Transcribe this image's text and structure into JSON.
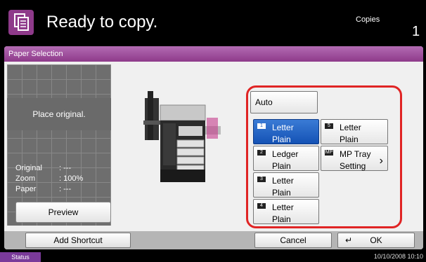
{
  "header": {
    "status": "Ready to copy.",
    "copies_label": "Copies",
    "copies_value": "1",
    "icon": "copy-icon"
  },
  "panel": {
    "title": "Paper Selection",
    "preview": {
      "message": "Place original.",
      "info": [
        {
          "label": "Original",
          "value": ": ---"
        },
        {
          "label": "Zoom",
          "value": ": 100%"
        },
        {
          "label": "Paper",
          "value": ": ---"
        }
      ],
      "button_label": "Preview"
    },
    "options": {
      "auto": "Auto",
      "items": [
        {
          "id": "cassette-1",
          "number": "1",
          "size": "Letter",
          "type": "Plain",
          "selected": true
        },
        {
          "id": "cassette-2",
          "number": "2",
          "size": "Ledger",
          "type": "Plain",
          "selected": false
        },
        {
          "id": "cassette-3",
          "number": "3",
          "size": "Letter",
          "type": "Plain",
          "selected": false
        },
        {
          "id": "cassette-4",
          "number": "4",
          "size": "Letter",
          "type": "Plain",
          "selected": false
        },
        {
          "id": "cassette-5",
          "number": "5",
          "size": "Letter",
          "type": "Plain",
          "selected": false
        },
        {
          "id": "mp-tray",
          "number": "MP",
          "size": "MP Tray",
          "type": "Setting",
          "selected": false
        }
      ]
    }
  },
  "footer_buttons": {
    "add_shortcut": "Add Shortcut",
    "cancel": "Cancel",
    "ok": "OK"
  },
  "statusbar": {
    "status_label": "Status",
    "datetime": "10/10/2008   10:10"
  },
  "colors": {
    "accent": "#8e3a8a",
    "selected": "#1452b5",
    "highlight": "#e02424"
  }
}
